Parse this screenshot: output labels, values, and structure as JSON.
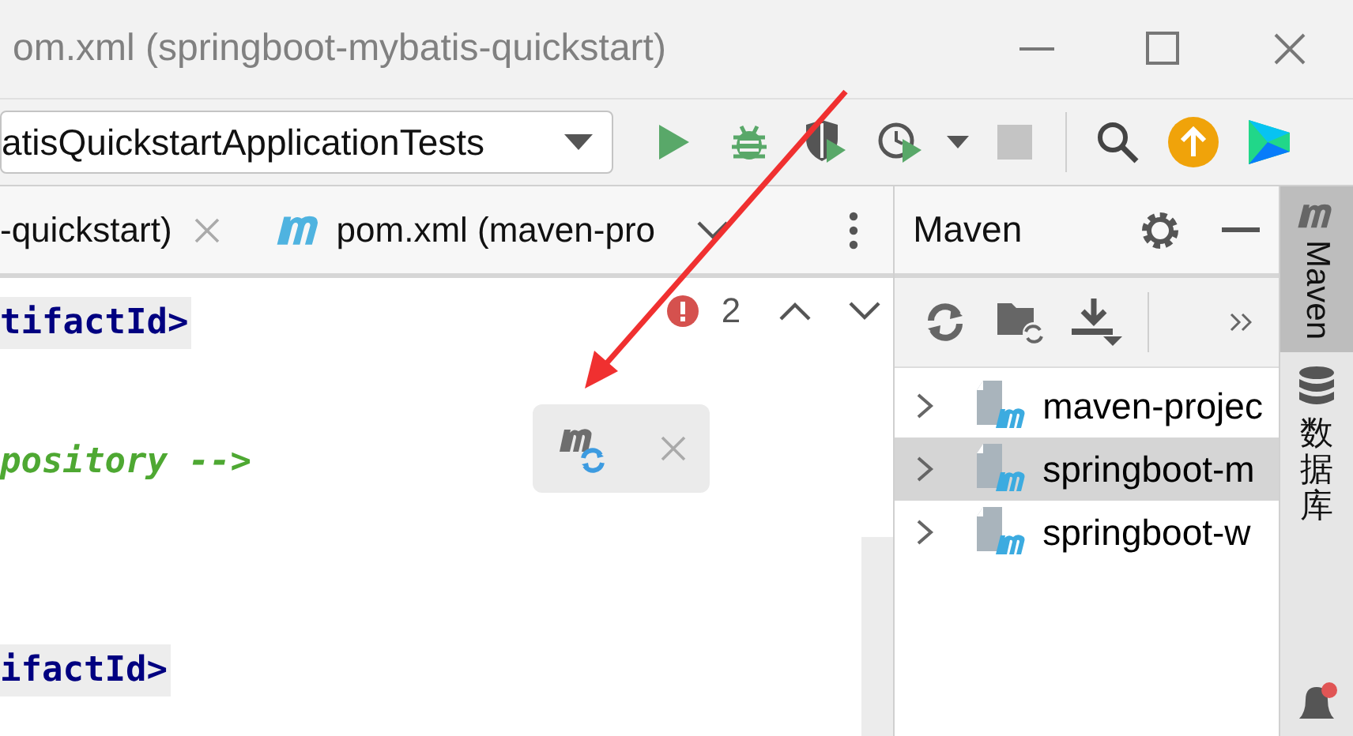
{
  "window": {
    "title": "om.xml (springboot-mybatis-quickstart)"
  },
  "run_config": {
    "value": "atisQuickstartApplicationTests"
  },
  "editor_tabs": [
    {
      "label": "-quickstart)",
      "kind": "plain"
    },
    {
      "label": "pom.xml (maven-pro",
      "kind": "maven"
    }
  ],
  "inspections": {
    "count": "2"
  },
  "code_lines": [
    {
      "text": "tifactId>",
      "kind": "tag"
    },
    {
      "kind": "blank"
    },
    {
      "text": "pository -->",
      "kind": "comment"
    },
    {
      "kind": "blank"
    },
    {
      "kind": "blank"
    },
    {
      "text": "ifactId>",
      "kind": "tag"
    }
  ],
  "maven": {
    "title": "Maven",
    "tree": [
      {
        "label": "maven-projec",
        "selected": false,
        "expanded": false
      },
      {
        "label": "springboot-m",
        "selected": true,
        "expanded": false
      },
      {
        "label": "springboot-w",
        "selected": false,
        "expanded": false
      }
    ]
  },
  "side_strip": [
    {
      "label": "Maven",
      "selected": true,
      "kind": "latin"
    },
    {
      "label": "数据库",
      "selected": false,
      "kind": "cjk"
    }
  ]
}
